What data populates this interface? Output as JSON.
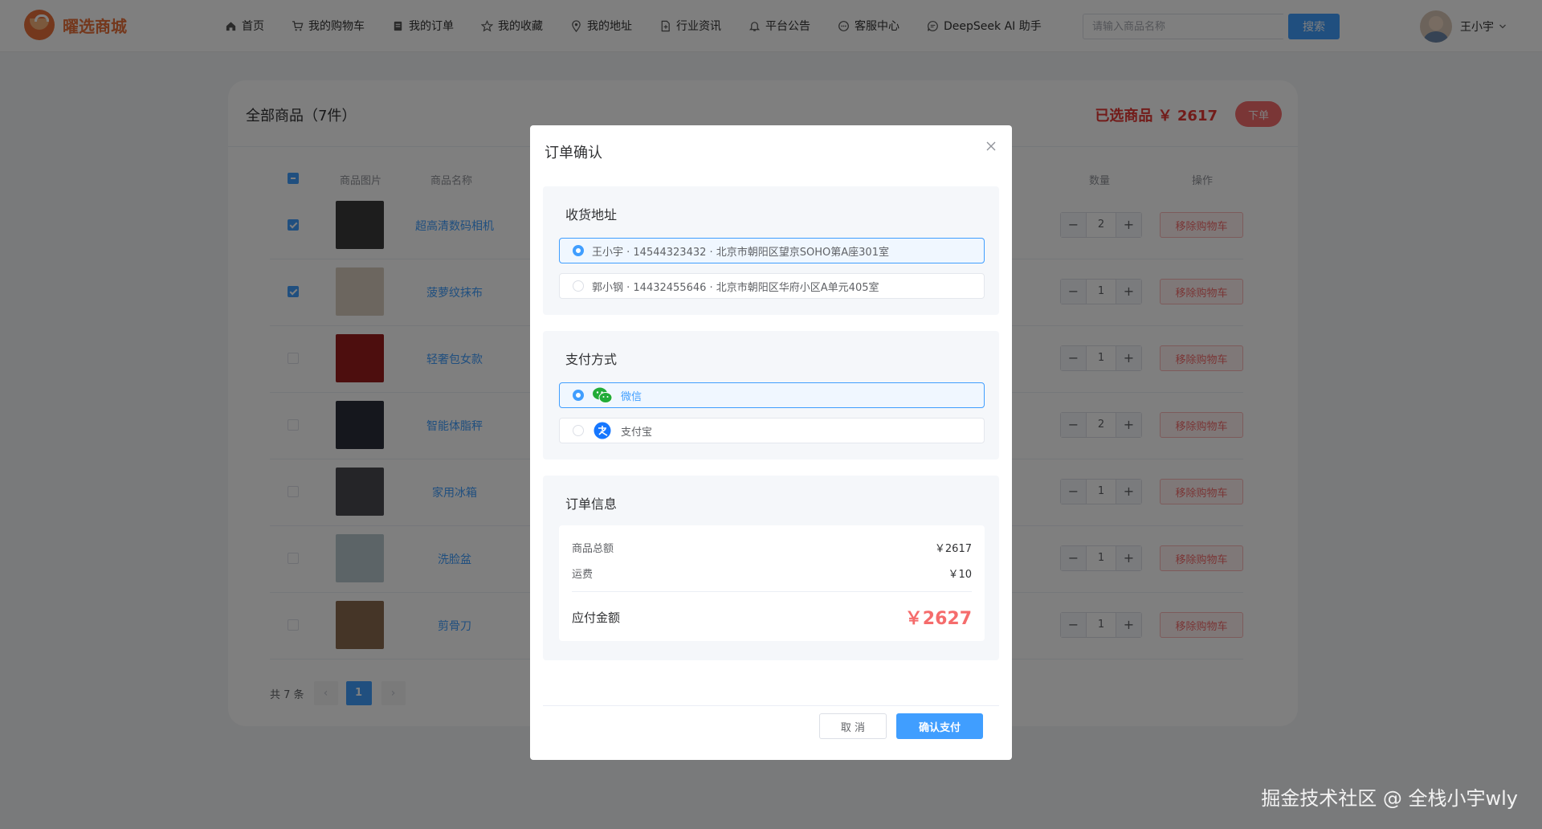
{
  "brand": {
    "name": "曜选商城",
    "accent": "#e8703a"
  },
  "nav": [
    {
      "label": "首页",
      "icon": "home-icon"
    },
    {
      "label": "我的购物车",
      "icon": "cart-icon"
    },
    {
      "label": "我的订单",
      "icon": "order-icon"
    },
    {
      "label": "我的收藏",
      "icon": "star-icon"
    },
    {
      "label": "我的地址",
      "icon": "location-icon"
    },
    {
      "label": "行业资讯",
      "icon": "document-icon"
    },
    {
      "label": "平台公告",
      "icon": "bell-icon"
    },
    {
      "label": "客服中心",
      "icon": "chat-icon"
    },
    {
      "label": "DeepSeek AI 助手",
      "icon": "ai-chat-icon"
    }
  ],
  "search": {
    "placeholder": "请输入商品名称",
    "value": "",
    "button": "搜索"
  },
  "user": {
    "name": "王小宇"
  },
  "cart": {
    "title": "全部商品（7件）",
    "selected_summary": "已选商品 ￥ 2617",
    "order_button": "下单",
    "columns": {
      "image": "商品图片",
      "name": "商品名称",
      "quantity": "数量",
      "action": "操作"
    },
    "items": [
      {
        "name": "超高清数码相机",
        "qty": "2",
        "checked": true,
        "thumb": "#3a3a3a",
        "remove": "移除购物车"
      },
      {
        "name": "菠萝纹抹布",
        "qty": "1",
        "checked": true,
        "thumb": "#d8cdbf",
        "remove": "移除购物车"
      },
      {
        "name": "轻奢包女款",
        "qty": "1",
        "checked": false,
        "thumb": "#9b1c1c",
        "remove": "移除购物车"
      },
      {
        "name": "智能体脂秤",
        "qty": "2",
        "checked": false,
        "thumb": "#2b2f3a",
        "remove": "移除购物车"
      },
      {
        "name": "家用冰箱",
        "qty": "1",
        "checked": false,
        "thumb": "#4a4a50",
        "remove": "移除购物车"
      },
      {
        "name": "洗脸盆",
        "qty": "1",
        "checked": false,
        "thumb": "#b8c9cf",
        "remove": "移除购物车"
      },
      {
        "name": "剪骨刀",
        "qty": "1",
        "checked": false,
        "thumb": "#8a6a4e",
        "remove": "移除购物车"
      }
    ],
    "pagination": {
      "total": "共 7 条",
      "page": "1"
    }
  },
  "dialog": {
    "title": "订单确认",
    "address": {
      "title": "收货地址",
      "options": [
        {
          "text": "王小宇 · 14544323432 · 北京市朝阳区望京SOHO第A座301室",
          "selected": true
        },
        {
          "text": "郭小钢 · 14432455646 · 北京市朝阳区华府小区A单元405室",
          "selected": false
        }
      ]
    },
    "payment": {
      "title": "支付方式",
      "options": [
        {
          "text": "微信",
          "icon": "wechat-pay-icon",
          "selected": true
        },
        {
          "text": "支付宝",
          "icon": "alipay-icon",
          "selected": false
        }
      ]
    },
    "order_info": {
      "title": "订单信息",
      "goods_total_label": "商品总额",
      "goods_total": "￥2617",
      "shipping_label": "运费",
      "shipping": "￥10",
      "due_label": "应付金额",
      "due": "￥2627"
    },
    "cancel_button": "取 消",
    "confirm_button": "确认支付"
  },
  "watermark": "掘金技术社区 @ 全栈小宇wly",
  "colors": {
    "primary": "#409eff",
    "danger": "#f56c6c"
  }
}
